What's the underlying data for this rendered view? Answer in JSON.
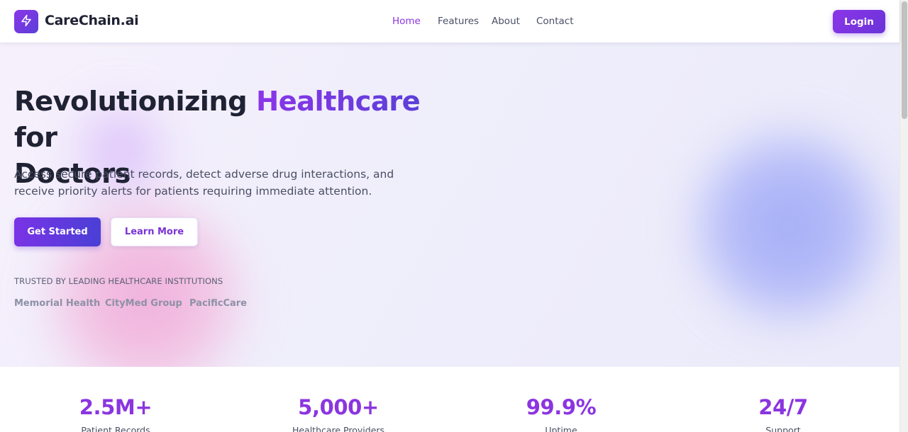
{
  "header": {
    "brand": "CareChain.ai",
    "logo_icon": "lightning-bolt-icon",
    "nav": [
      {
        "label": "Home",
        "active": true
      },
      {
        "label": "Features",
        "active": false
      },
      {
        "label": "About",
        "active": false
      },
      {
        "label": "Contact",
        "active": false
      }
    ],
    "login_label": "Login"
  },
  "hero": {
    "title_part1": "Revolutionizing",
    "title_accent": "Healthcare",
    "title_part2": "for",
    "title_line2": "Doctors",
    "subtitle": "Access secure patient records, detect adverse drug interactions, and receive priority alerts for patients requiring immediate attention.",
    "primary_cta": "Get Started",
    "secondary_cta": "Learn More",
    "trusted_label": "TRUSTED BY LEADING HEALTHCARE INSTITUTIONS",
    "partners": [
      "Memorial Health",
      "CityMed Group",
      "PacificCare"
    ]
  },
  "stats": [
    {
      "value": "2.5M+",
      "label": "Patient Records"
    },
    {
      "value": "5,000+",
      "label": "Healthcare Providers"
    },
    {
      "value": "99.9%",
      "label": "Uptime"
    },
    {
      "value": "24/7",
      "label": "Support"
    }
  ],
  "colors": {
    "accent": "#8b35e0",
    "accent_secondary": "#5b3fd8",
    "text_dark": "#1f2233",
    "text_muted": "#4a4e63",
    "hero_bg": "#efeefb"
  }
}
